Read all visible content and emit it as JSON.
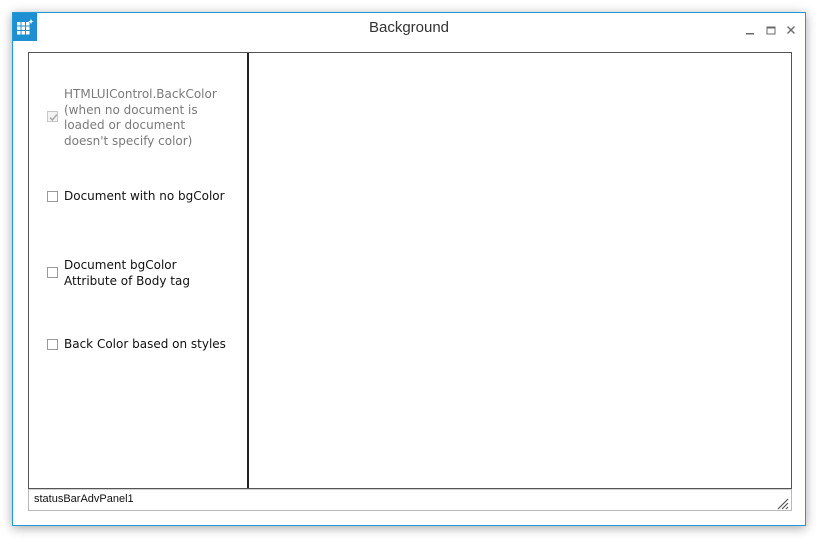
{
  "window": {
    "title": "Background",
    "accent_color": "#1e90d2",
    "icon": "grid-app-icon",
    "controls": [
      "minimize-icon",
      "maximize-icon",
      "close-icon"
    ]
  },
  "options": [
    {
      "label": "HTMLUIControl.BackColor\n(when no document is\nloaded or document\ndoesn't specify color)",
      "checked": true,
      "enabled": false
    },
    {
      "label": "Document with no bgColor",
      "checked": false,
      "enabled": true
    },
    {
      "label": "Document bgColor\nAttribute of Body tag",
      "checked": false,
      "enabled": true
    },
    {
      "label": "Back Color based on styles",
      "checked": false,
      "enabled": true
    }
  ],
  "statusbar": {
    "panel_text": "statusBarAdvPanel1",
    "grip_icon": "resize-grip-icon"
  }
}
